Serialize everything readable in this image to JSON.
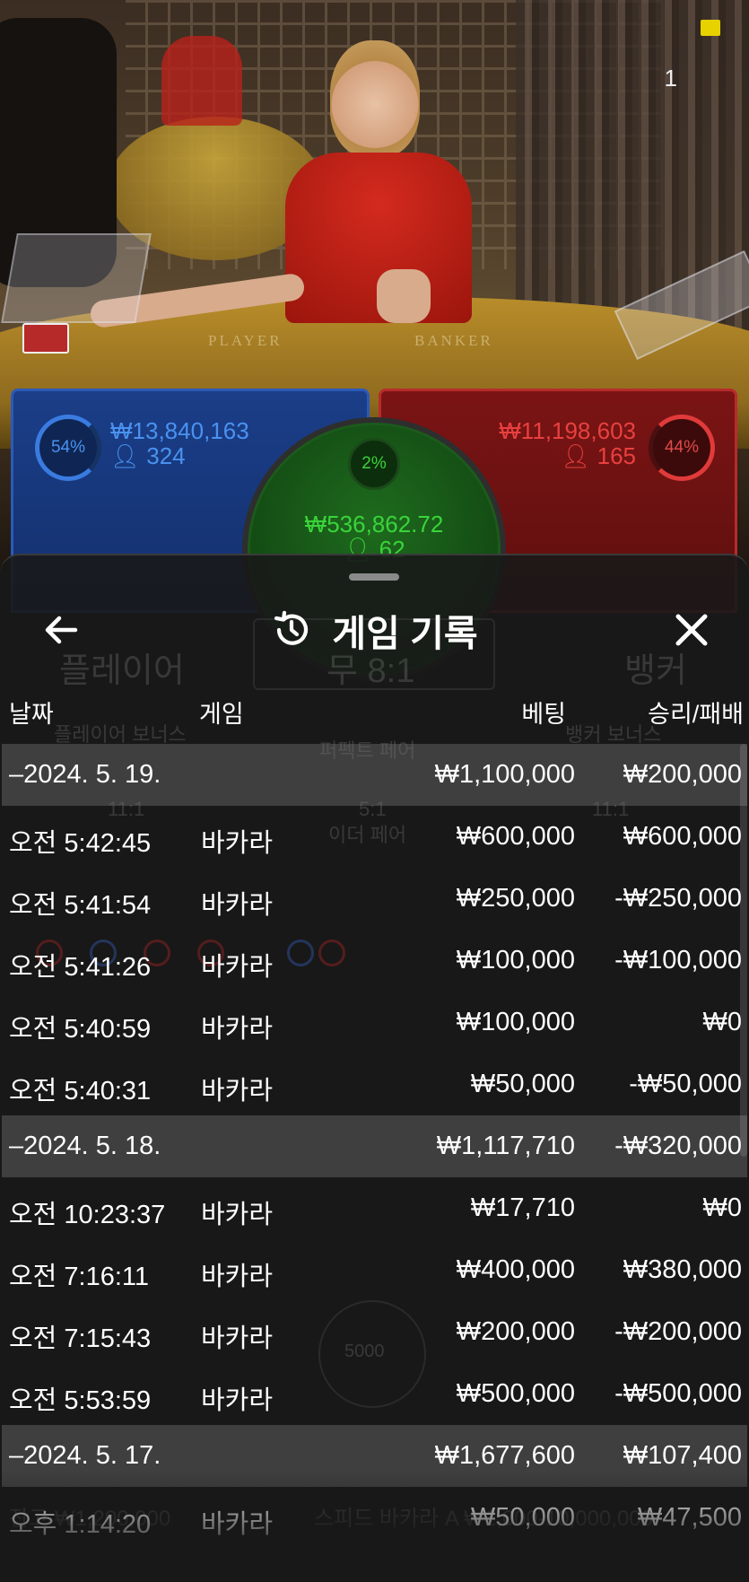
{
  "scene": {
    "viewer_count": "1",
    "table_labels": {
      "player": "PLAYER",
      "banker": "BANKER"
    }
  },
  "bets": {
    "player": {
      "percent": "54%",
      "amount": "₩13,840,163",
      "players": "324"
    },
    "banker": {
      "percent": "44%",
      "amount": "₩11,198,603",
      "players": "165"
    },
    "tie": {
      "percent": "2%",
      "amount": "₩536,862.72",
      "players": "62"
    }
  },
  "background_ghost": {
    "player_label": "플레이어",
    "tie_label": "무 8:1",
    "banker_label": "뱅커",
    "player_bonus": "플레이어 보너스",
    "banker_bonus": "뱅커 보너스",
    "perfect_pair": "퍼펙트 페어",
    "either_pair": "이더 페어",
    "ratio_1": "11:1",
    "ratio_2": "5:1",
    "footer_left": "잔고 ₩1,200,000",
    "footer_right": "스피드 바카라 A ₩1,000-10,000,000",
    "chip": "5000"
  },
  "history_sheet": {
    "title": "게임 기록",
    "icons": {
      "back": "arrow-left-icon",
      "history": "history-icon",
      "close": "close-icon"
    },
    "columns": {
      "date": "날짜",
      "game": "게임",
      "bet": "베팅",
      "result": "승리/패배"
    },
    "rows": [
      {
        "type": "date",
        "label": "–2024. 5. 19.",
        "game": "",
        "bet": "₩1,100,000",
        "result": "₩200,000"
      },
      {
        "type": "game",
        "label": "오전 5:42:45",
        "game": "바카라",
        "bet": "₩600,000",
        "result": "₩600,000"
      },
      {
        "type": "game",
        "label": "오전 5:41:54",
        "game": "바카라",
        "bet": "₩250,000",
        "result": "-₩250,000"
      },
      {
        "type": "game",
        "label": "오전 5:41:26",
        "game": "바카라",
        "bet": "₩100,000",
        "result": "-₩100,000"
      },
      {
        "type": "game",
        "label": "오전 5:40:59",
        "game": "바카라",
        "bet": "₩100,000",
        "result": "₩0"
      },
      {
        "type": "game",
        "label": "오전 5:40:31",
        "game": "바카라",
        "bet": "₩50,000",
        "result": "-₩50,000"
      },
      {
        "type": "date",
        "label": "–2024. 5. 18.",
        "game": "",
        "bet": "₩1,117,710",
        "result": "-₩320,000"
      },
      {
        "type": "game",
        "label": "오전 10:23:37",
        "game": "바카라",
        "bet": "₩17,710",
        "result": "₩0"
      },
      {
        "type": "game",
        "label": "오전 7:16:11",
        "game": "바카라",
        "bet": "₩400,000",
        "result": "₩380,000"
      },
      {
        "type": "game",
        "label": "오전 7:15:43",
        "game": "바카라",
        "bet": "₩200,000",
        "result": "-₩200,000"
      },
      {
        "type": "game",
        "label": "오전 5:53:59",
        "game": "바카라",
        "bet": "₩500,000",
        "result": "-₩500,000"
      },
      {
        "type": "date",
        "label": "–2024. 5. 17.",
        "game": "",
        "bet": "₩1,677,600",
        "result": "₩107,400"
      },
      {
        "type": "game",
        "label": "오후 1:14:20",
        "game": "바카라",
        "bet": "₩50,000",
        "result": "₩47,500"
      }
    ]
  }
}
